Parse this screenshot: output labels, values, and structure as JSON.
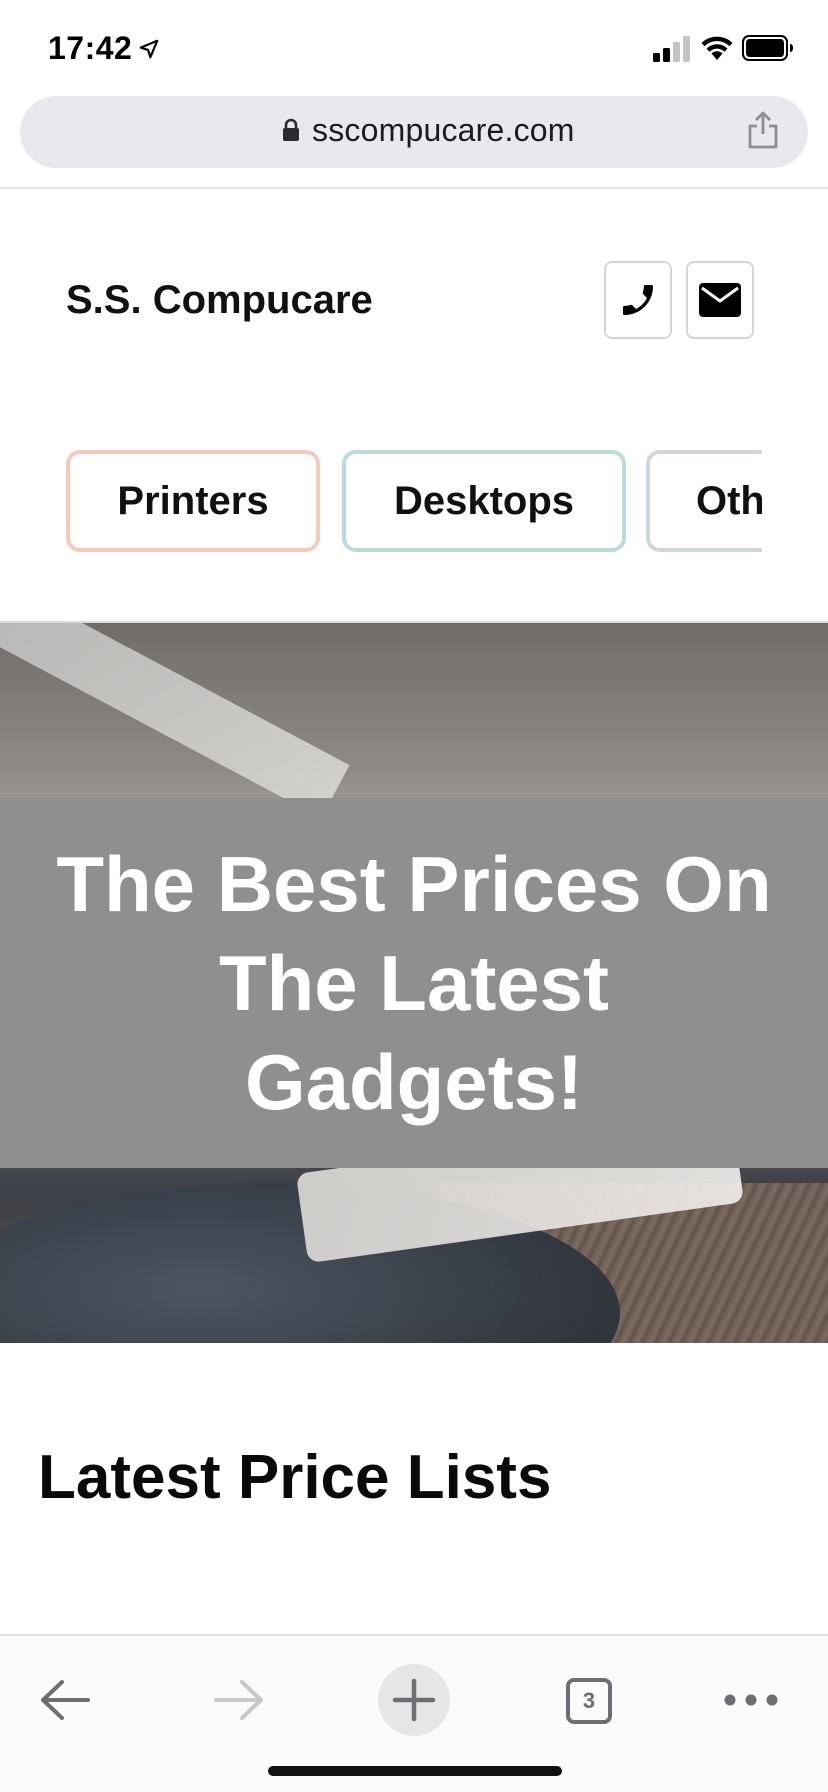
{
  "status_bar": {
    "time": "17:42"
  },
  "browser": {
    "url": "sscompucare.com",
    "tab_count": "3"
  },
  "site": {
    "name": "S.S. Compucare"
  },
  "categories": [
    {
      "label": "Printers"
    },
    {
      "label": "Desktops"
    },
    {
      "label": "Oth"
    }
  ],
  "hero": {
    "title": "The Best Prices On The Latest Gadgets!"
  },
  "section": {
    "title": "Latest Price Lists"
  },
  "colors": {
    "printers_border": "#f5c9bc",
    "desktops_border": "#b9dcd9",
    "other_border": "#d0d6dc",
    "hero_overlay": "#8f8f8f"
  }
}
